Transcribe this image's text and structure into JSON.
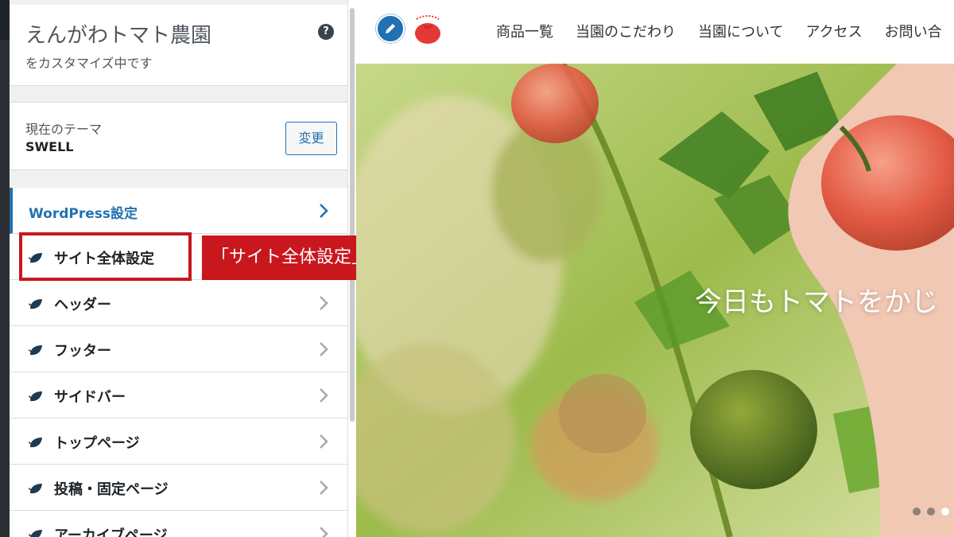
{
  "panel": {
    "site_title": "えんがわトマト農園",
    "subtitle": "をカスタマイズ中です",
    "help_icon": "question-circle-icon",
    "theme_label": "現在のテーマ",
    "theme_name": "SWELL",
    "change_button": "変更"
  },
  "menu": {
    "items": [
      {
        "label": "WordPress設定",
        "icon": "none",
        "active": true
      },
      {
        "label": "サイト全体設定",
        "icon": "swell-leaf-icon"
      },
      {
        "label": "ヘッダー",
        "icon": "swell-leaf-icon"
      },
      {
        "label": "フッター",
        "icon": "swell-leaf-icon"
      },
      {
        "label": "サイドバー",
        "icon": "swell-leaf-icon"
      },
      {
        "label": "トップページ",
        "icon": "swell-leaf-icon"
      },
      {
        "label": "投稿・固定ページ",
        "icon": "swell-leaf-icon"
      },
      {
        "label": "アーカイブページ",
        "icon": "swell-leaf-icon"
      }
    ]
  },
  "annotation": {
    "callout": "「サイト全体設定」をクリック",
    "color": "#c8171d"
  },
  "preview": {
    "nav": [
      "商品一覧",
      "当園のこだわり",
      "当園について",
      "アクセス",
      "お問い合"
    ],
    "hero_text": "今日もトマトをかじ",
    "slides": 3,
    "active_slide": 3
  },
  "colors": {
    "accent": "#2271b1",
    "leaf": "#1d3b52",
    "annotation": "#c8171d"
  }
}
